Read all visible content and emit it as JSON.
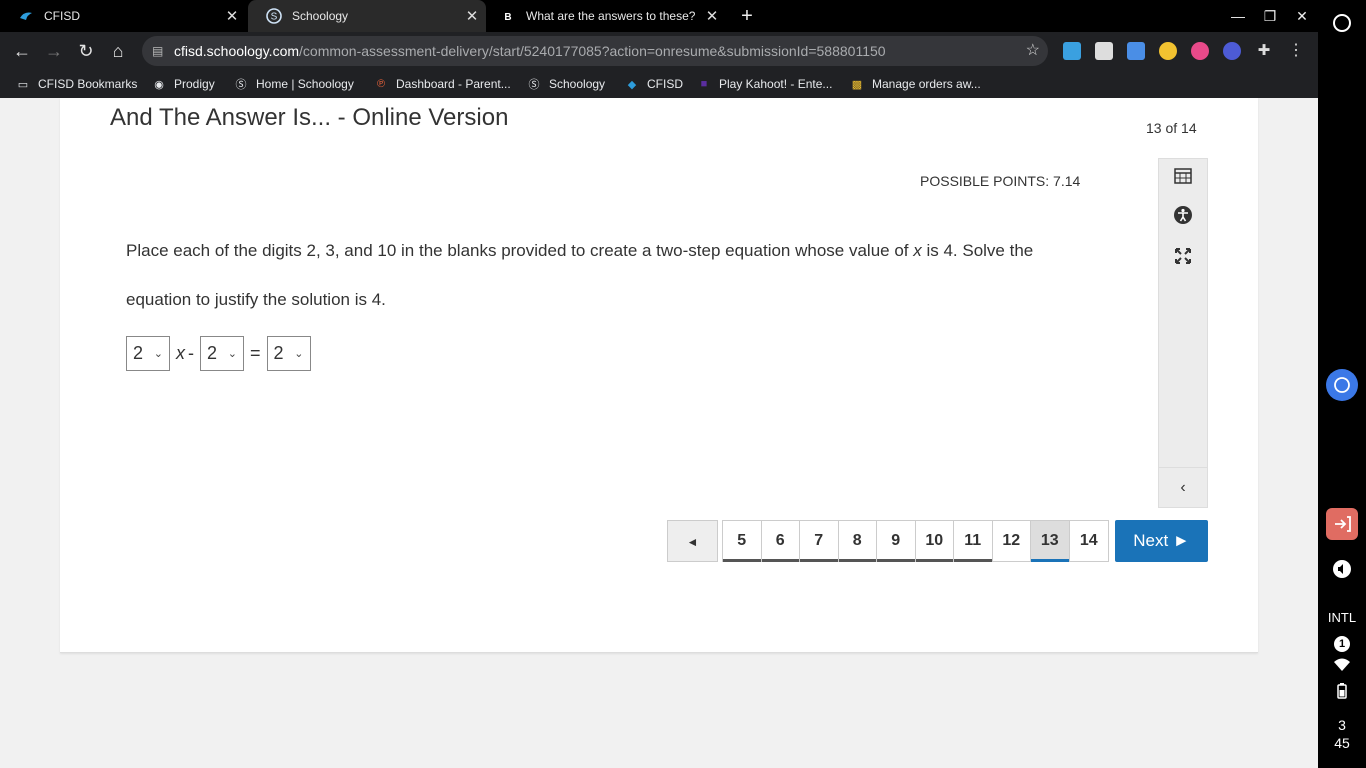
{
  "tabs": [
    {
      "title": "CFISD",
      "close": "✕"
    },
    {
      "title": "Schoology",
      "close": "✕"
    },
    {
      "title": "What are the answers to these? ·",
      "close": "✕"
    }
  ],
  "new_tab": "+",
  "window": {
    "minimize": "—",
    "restore": "❐",
    "close": "✕"
  },
  "address": {
    "host": "cfisd.schoology.com",
    "path": "/common-assessment-delivery/start/5240177085?action=onresume&submissionId=588801150"
  },
  "bookmarks": [
    "CFISD Bookmarks",
    "Prodigy",
    "Home | Schoology",
    "Dashboard - Parent...",
    "Schoology",
    "CFISD",
    "Play Kahoot! - Ente...",
    "Manage orders aw..."
  ],
  "assessment": {
    "title": "And The Answer Is... - Online Version",
    "counter": "13 of 14",
    "points": "POSSIBLE POINTS: 7.14",
    "question_part1": "Place each of the digits 2, 3, and 10 in the blanks provided to create a two-step equation whose value of ",
    "question_var": "x",
    "question_part2": " is 4.  Solve the equation to justify the solution is 4.",
    "equation": {
      "select1": "2",
      "var": "x",
      "minus": "-",
      "select2": "2",
      "equals": "=",
      "select3": "2"
    }
  },
  "pager": {
    "prev": "◄",
    "pages": [
      "5",
      "6",
      "7",
      "8",
      "9",
      "10",
      "11",
      "12",
      "13",
      "14"
    ],
    "current": "13",
    "next": "Next ►"
  },
  "shelf": {
    "ime": "INTL",
    "notifications": "1",
    "time_hour": "3",
    "time_min": "45"
  },
  "colors": {
    "accent": "#1a73b8",
    "chrome_bg": "#202124"
  }
}
